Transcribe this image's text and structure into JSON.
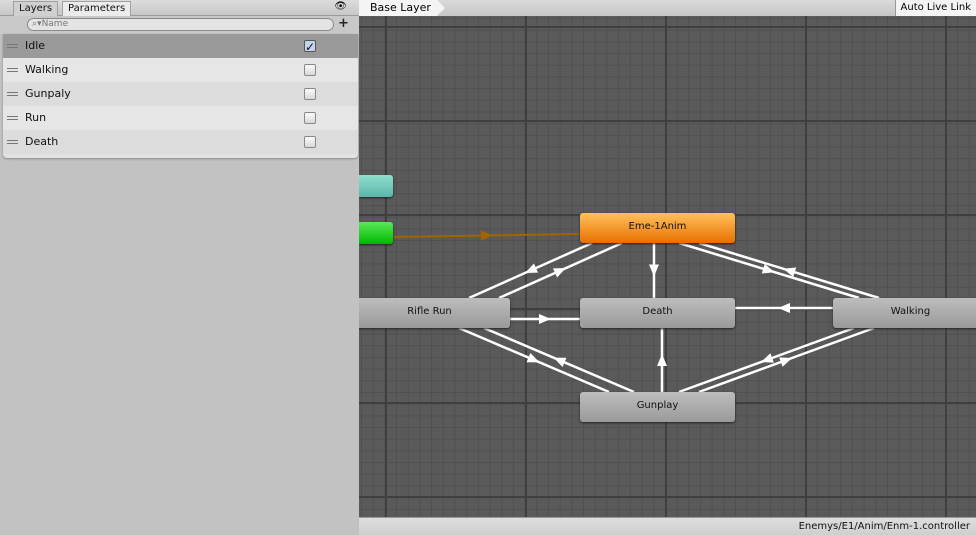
{
  "tabs": [
    {
      "label": "Layers",
      "active": false
    },
    {
      "label": "Parameters",
      "active": true
    }
  ],
  "eye_icon": "eye-icon",
  "search": {
    "placeholder": "Name",
    "icon": "search-dropdown-icon"
  },
  "add_button": "+",
  "parameters": [
    {
      "name": "Idle",
      "value": true,
      "selected": true
    },
    {
      "name": "Walking",
      "value": false
    },
    {
      "name": "Gunpaly",
      "value": false
    },
    {
      "name": "Run",
      "value": false
    },
    {
      "name": "Death",
      "value": false
    }
  ],
  "breadcrumb": "Base Layer",
  "auto_live_link": "Auto Live Link",
  "states": {
    "default": "Eme-1Anim",
    "rifle_run": "Rifle Run",
    "death": "Death",
    "walking": "Walking",
    "gunplay": "Gunplay"
  },
  "colors": {
    "default_state": "#f08a10",
    "any_state": "#6cc7b8",
    "entry": "#10c810",
    "entry_transition": "#a06400",
    "transition": "#ffffff"
  },
  "status_path": "Enemys/E1/Anim/Enm-1.controller"
}
